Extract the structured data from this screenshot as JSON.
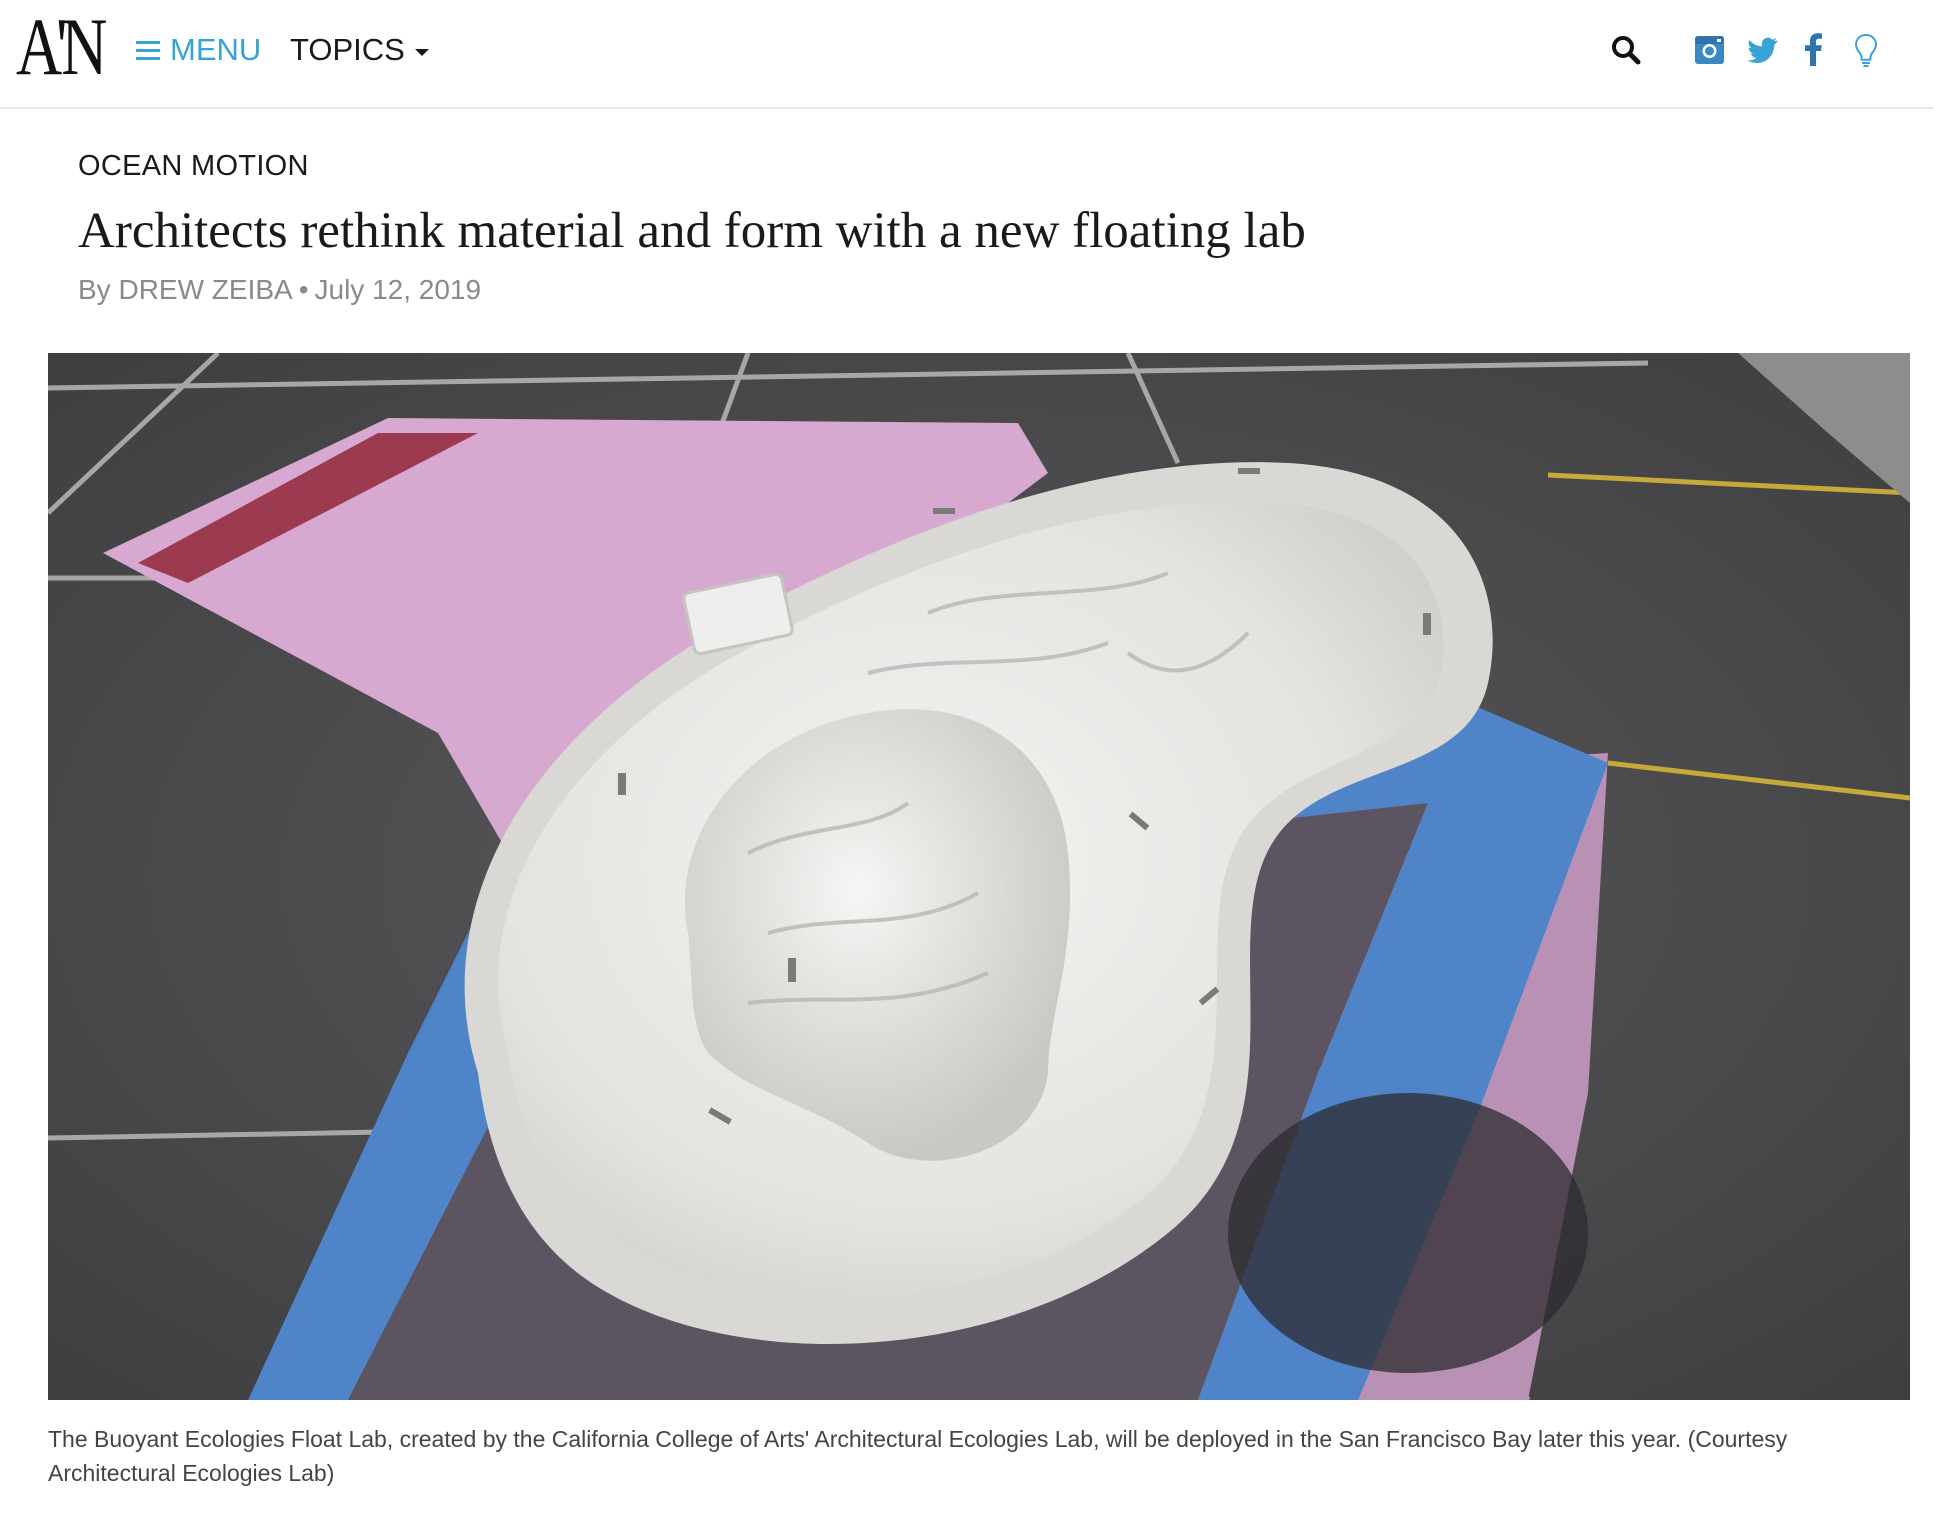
{
  "header": {
    "logo_text": "A'N",
    "menu_label": "MENU",
    "topics_label": "TOPICS",
    "icons": [
      "search-icon",
      "instagram-icon",
      "twitter-icon",
      "facebook-icon",
      "lightbulb-icon"
    ],
    "accent_color": "#3aa3d6"
  },
  "article": {
    "kicker": "OCEAN MOTION",
    "title": "Architects rethink material and form with a new floating lab",
    "byline_prefix": "By",
    "author": "DREW ZEIBA",
    "date": "July 12, 2019",
    "caption": "The Buoyant Ecologies Float Lab, created by the California College of Arts' Architectural Ecologies Lab, will be deployed in the San Francisco Bay later this year. (Courtesy Architectural Ecologies Lab)"
  }
}
